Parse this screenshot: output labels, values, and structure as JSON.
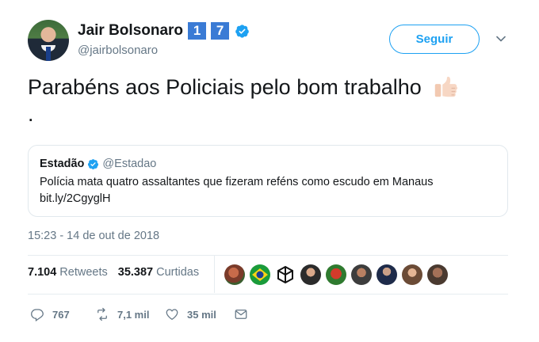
{
  "author": {
    "name": "Jair Bolsonaro",
    "badge_digits": [
      "1",
      "7"
    ],
    "handle": "@jairbolsonaro",
    "verified_icon": "verified-badge-icon"
  },
  "follow_button": {
    "label": "Seguir"
  },
  "menu_icon": "chevron-down-icon",
  "tweet": {
    "text": "Parabéns aos Policiais pelo bom trabalho",
    "emoji_icon": "thumbs-up-icon",
    "trailing": "."
  },
  "quoted_tweet": {
    "name": "Estadão",
    "handle": "@Estadao",
    "text": "Polícia mata quatro assaltantes que fizeram reféns como escudo em Manaus",
    "link": "bit.ly/2CgyglH"
  },
  "timestamp": "15:23 - 14 de out de 2018",
  "stats": {
    "retweets_count": "7.104",
    "retweets_label": "Retweets",
    "likes_count": "35.387",
    "likes_label": "Curtidas"
  },
  "likers_avatars": 9,
  "actions": {
    "reply_count": "767",
    "retweet_count": "7,1 mil",
    "like_count": "35 mil"
  },
  "colors": {
    "accent": "#1da1f2",
    "secondary_text": "#657786",
    "badge_blue": "#3a7bd5"
  }
}
